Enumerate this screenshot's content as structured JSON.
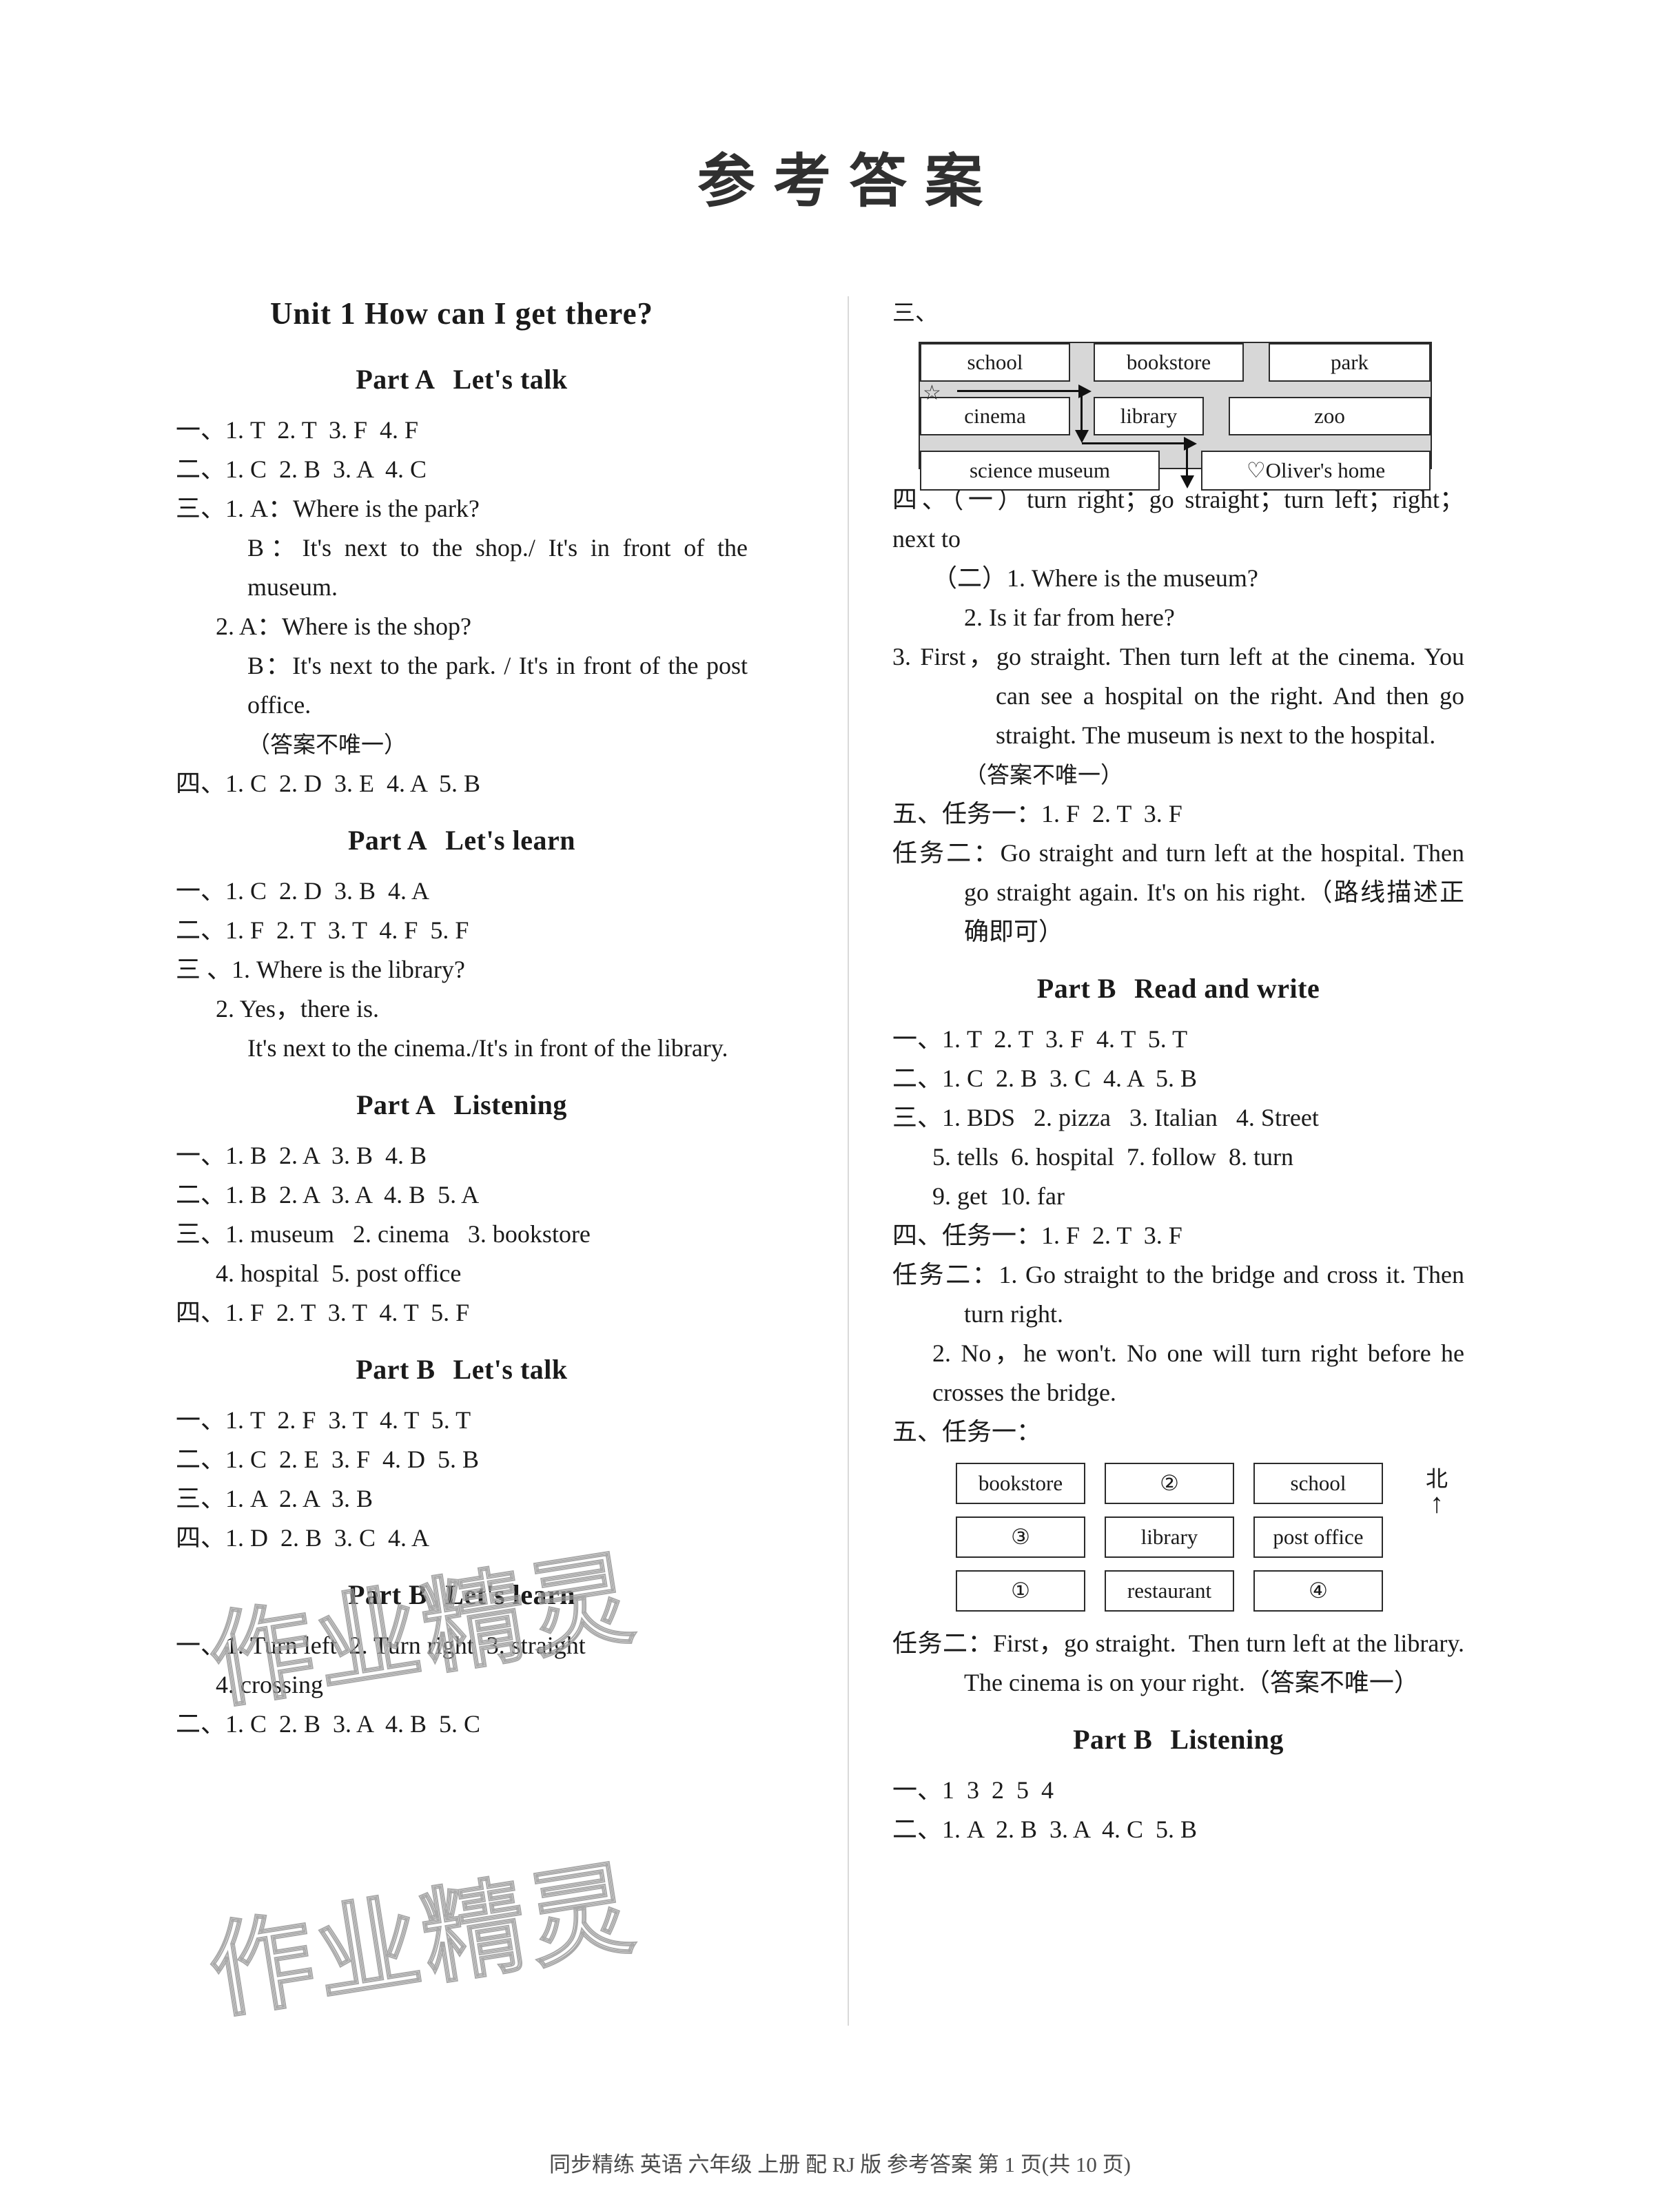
{
  "document": {
    "title": "参考答案",
    "footer": "同步精练  英语  六年级  上册  配 RJ 版  参考答案  第 1 页(共 10 页)",
    "watermark": "作业精灵"
  },
  "left_column": {
    "unit_heading": "Unit 1   How can I get there?",
    "sections": [
      {
        "part": "Part A",
        "sub": "Let's talk",
        "lines": [
          "一、1. T  2. T  3. F  4. F",
          "二、1. C  2. B  3. A  4. C",
          "三、1. A：Where is the park?",
          "B：It's next to the shop./ It's in front of the museum.",
          "2. A：Where is the shop?",
          "B：It's next to the park. / It's in front of the post office.",
          "（答案不唯一）",
          "四、1. C  2. D  3. E  4. A  5. B"
        ]
      },
      {
        "part": "Part A",
        "sub": "Let's learn",
        "lines": [
          "一、1. C  2. D  3. B  4. A",
          "二、1. F  2. T  3. T  4. F  5. F",
          "三 、1. Where is the library?",
          "2. Yes，there is.",
          "It's next to the cinema./It's in front of the library."
        ]
      },
      {
        "part": "Part A",
        "sub": "Listening",
        "lines": [
          "一、1. B  2. A  3. B  4. B",
          "二、1. B  2. A  3. A  4. B  5. A",
          "三、1. museum   2. cinema   3. bookstore",
          "4. hospital  5. post office",
          "四、1. F  2. T  3. T  4. T  5. F"
        ]
      },
      {
        "part": "Part B",
        "sub": "Let's talk",
        "lines": [
          "一、1. T  2. F  3. T  4. T  5. T",
          "二、1. C  2. E  3. F  4. D  5. B",
          "三、1. A  2. A  3. B",
          "四、1. D  2. B  3. C  4. A"
        ]
      },
      {
        "part": "Part B",
        "sub": "Let's learn",
        "lines": [
          "一、1. Turn left  2. Turn right  3. straight",
          "4. crossing",
          "二、1. C  2. B  3. A  4. B  5. C"
        ]
      }
    ]
  },
  "right_column": {
    "map_label": "三、",
    "map_diagram": {
      "cells": [
        {
          "label": "school",
          "row": 1,
          "col": 1
        },
        {
          "label": "bookstore",
          "row": 1,
          "col": 2
        },
        {
          "label": "park",
          "row": 1,
          "col": 3
        },
        {
          "label": "cinema",
          "row": 2,
          "col": 1
        },
        {
          "label": "library",
          "row": 2,
          "col": 2
        },
        {
          "label": "zoo",
          "row": 2,
          "col": 3
        },
        {
          "label": "science museum",
          "row": 3,
          "col": 1
        },
        {
          "label": "♡Oliver's home",
          "row": 3,
          "col": 3
        }
      ],
      "start_marker": "☆"
    },
    "after_map_lines": [
      "四、（一）turn right；go straight；turn left；right；next to",
      "（二）1. Where is the museum?",
      "2. Is it far from here?",
      "3. First，go straight. Then turn left at the cinema. You can see a hospital on the right. And then go straight. The museum is next to the hospital.",
      "（答案不唯一）",
      "五、任务一：1. F  2. T  3. F",
      "任务二：Go straight and turn left at the hospital. Then go straight again. It's on his right.（路线描述正确即可）"
    ],
    "sections": [
      {
        "part": "Part B",
        "sub": "Read and write",
        "lines": [
          "一、1. T  2. T  3. F  4. T  5. T",
          "二、1. C  2. B  3. C  4. A  5. B",
          "三、1. BDS   2. pizza   3. Italian   4. Street",
          "5. tells  6. hospital  7. follow  8. turn",
          "9. get  10. far",
          "四、任务一：1. F  2. T  3. F",
          "任务二：1. Go straight to the bridge and cross it. Then turn right.",
          "2. No，he won't. No one will turn right before he crosses the bridge.",
          "五、任务一："
        ]
      }
    ],
    "grid_diagram": {
      "rows": [
        [
          "bookstore",
          "②",
          "school"
        ],
        [
          "③",
          "library",
          "post office"
        ],
        [
          "①",
          "restaurant",
          "④"
        ]
      ],
      "compass_label": "北",
      "compass_needle": "↑"
    },
    "after_grid_lines": [
      "任务二：First，go straight.  Then turn left at the library. The cinema is on your right.（答案不唯一）"
    ],
    "listening_section": {
      "part": "Part B",
      "sub": "Listening",
      "lines": [
        "一、1  3  2  5  4",
        "二、1. A  2. B  3. A  4. C  5. B"
      ]
    }
  }
}
